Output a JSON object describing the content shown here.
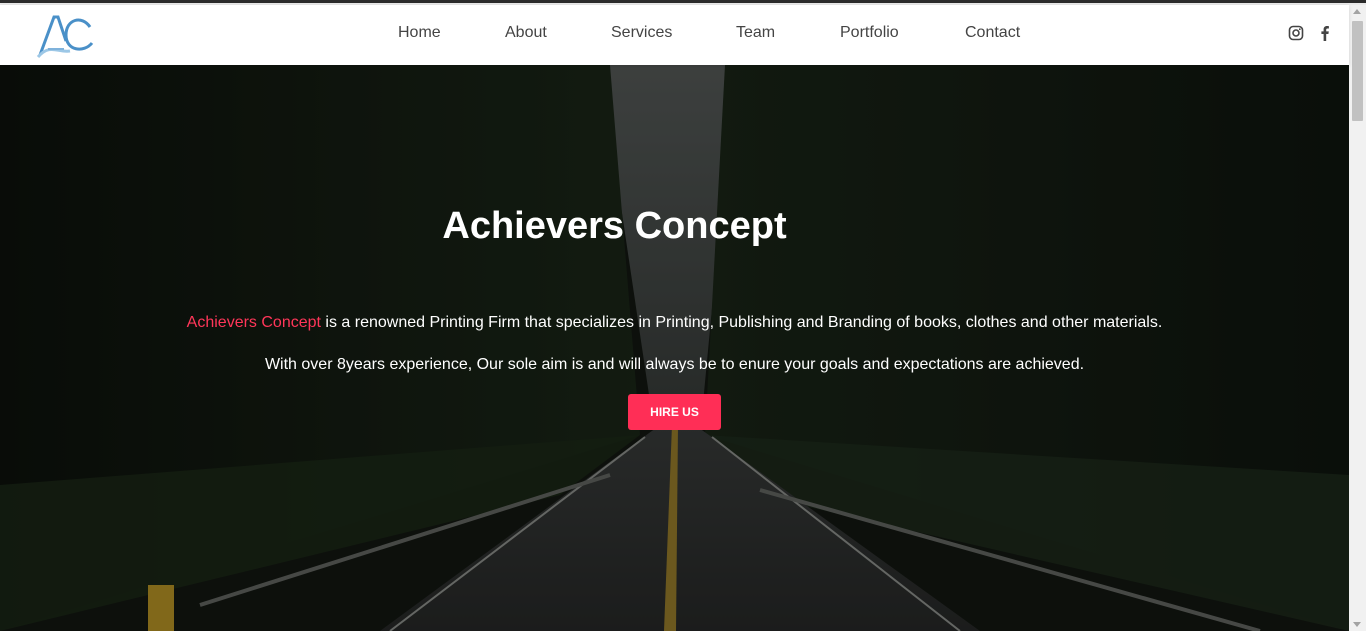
{
  "brand": {
    "logo_text": "AC",
    "colors": {
      "accent": "#ff2e56",
      "logo_blue": "#4a90c8",
      "logo_light": "#9cc7e6"
    }
  },
  "nav": {
    "items": [
      {
        "label": "Home"
      },
      {
        "label": "About"
      },
      {
        "label": "Services"
      },
      {
        "label": "Team"
      },
      {
        "label": "Portfolio"
      },
      {
        "label": "Contact"
      }
    ],
    "social": [
      {
        "icon": "instagram-icon"
      },
      {
        "icon": "facebook-icon"
      }
    ]
  },
  "hero": {
    "title": "Achievers Concept",
    "intro_highlight": "Achievers Concept",
    "intro_rest": " is a renowned Printing Firm that specializes in Printing, Publishing and Branding of books, clothes and other materials.",
    "aim": "With over 8years experience, Our sole aim is and will always be to enure your goals and expectations are achieved.",
    "cta_label": "HIRE US",
    "background": "forest-road-image"
  }
}
